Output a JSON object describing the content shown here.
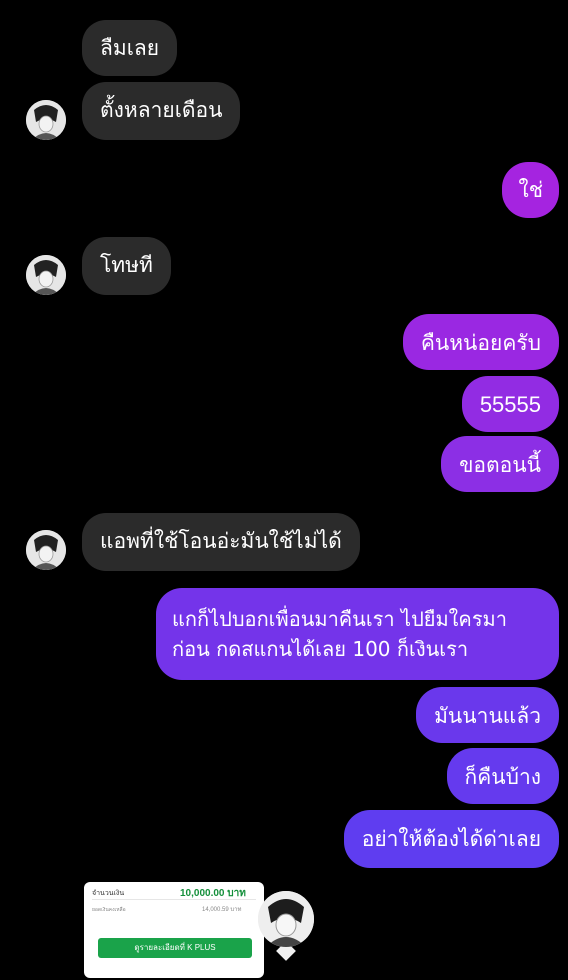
{
  "chat": {
    "messages": [
      {
        "sender": "other",
        "text": "ลืมเลย"
      },
      {
        "sender": "other",
        "text": "ตั้งหลายเดือน"
      },
      {
        "sender": "me",
        "text": "ใช่"
      },
      {
        "sender": "other",
        "text": "โทษที"
      },
      {
        "sender": "me",
        "text": "คืนหน่อยครับ"
      },
      {
        "sender": "me",
        "text": "55555"
      },
      {
        "sender": "me",
        "text": "ขอตอนนี้"
      },
      {
        "sender": "other",
        "text": "แอพที่ใช้โอนอ่ะมันใช้ไม่ได้"
      },
      {
        "sender": "me",
        "text": "แกก็ไปบอกเพื่อนมาคืนเรา ไปยืมใครมาก่อน กดสแกนได้เลย 100 ก็เงินเรา"
      },
      {
        "sender": "me",
        "text": "มันนานแล้ว"
      },
      {
        "sender": "me",
        "text": "ก็คืนบ้าง"
      },
      {
        "sender": "me",
        "text": "อย่าให้ต้องได้ด่าเลย"
      }
    ],
    "colors": {
      "background": "#000000",
      "incoming_bubble": "#2b2b2b",
      "outgoing_gradient_top": "#a524e0",
      "outgoing_gradient_bottom": "#5e3df0"
    }
  },
  "receipt": {
    "amount_label": "จำนวนเงิน",
    "amount_value": "10,000.00 บาท",
    "sub_label": "ยอดเงินคงเหลือ",
    "sub_value": "14,000.59 บาท",
    "button_label": "ดูรายละเอียดที่ K PLUS",
    "button_color": "#1aa34a"
  },
  "icons": {
    "avatar": "avatar-icon"
  }
}
